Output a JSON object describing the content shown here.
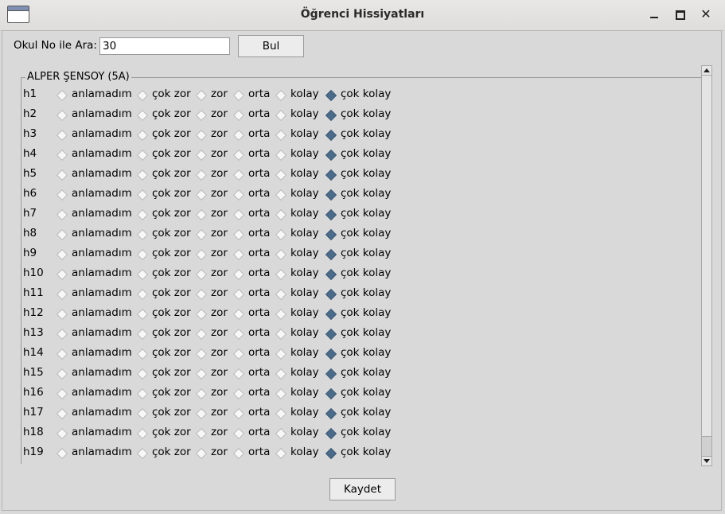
{
  "window": {
    "title": "Öğrenci Hissiyatları",
    "close_symbol": "✕"
  },
  "search": {
    "label": "Okul No ile Ara:",
    "value": "30",
    "button_label": "Bul"
  },
  "group": {
    "title": "ALPER ŞENSOY (5A)"
  },
  "options": [
    "anlamadım",
    "çok zor",
    "zor",
    "orta",
    "kolay",
    "çok kolay"
  ],
  "rows": [
    {
      "label": "h1",
      "selected": 5
    },
    {
      "label": "h2",
      "selected": 5
    },
    {
      "label": "h3",
      "selected": 5
    },
    {
      "label": "h4",
      "selected": 5
    },
    {
      "label": "h5",
      "selected": 5
    },
    {
      "label": "h6",
      "selected": 5
    },
    {
      "label": "h7",
      "selected": 5
    },
    {
      "label": "h8",
      "selected": 5
    },
    {
      "label": "h9",
      "selected": 5
    },
    {
      "label": "h10",
      "selected": 5
    },
    {
      "label": "h11",
      "selected": 5
    },
    {
      "label": "h12",
      "selected": 5
    },
    {
      "label": "h13",
      "selected": 5
    },
    {
      "label": "h14",
      "selected": 5
    },
    {
      "label": "h15",
      "selected": 5
    },
    {
      "label": "h16",
      "selected": 5
    },
    {
      "label": "h17",
      "selected": 5
    },
    {
      "label": "h18",
      "selected": 5
    },
    {
      "label": "h19",
      "selected": 5
    }
  ],
  "footer": {
    "save_label": "Kaydet"
  },
  "colors": {
    "selected_radio": "#4a6b8a",
    "background": "#d9d9d9"
  }
}
